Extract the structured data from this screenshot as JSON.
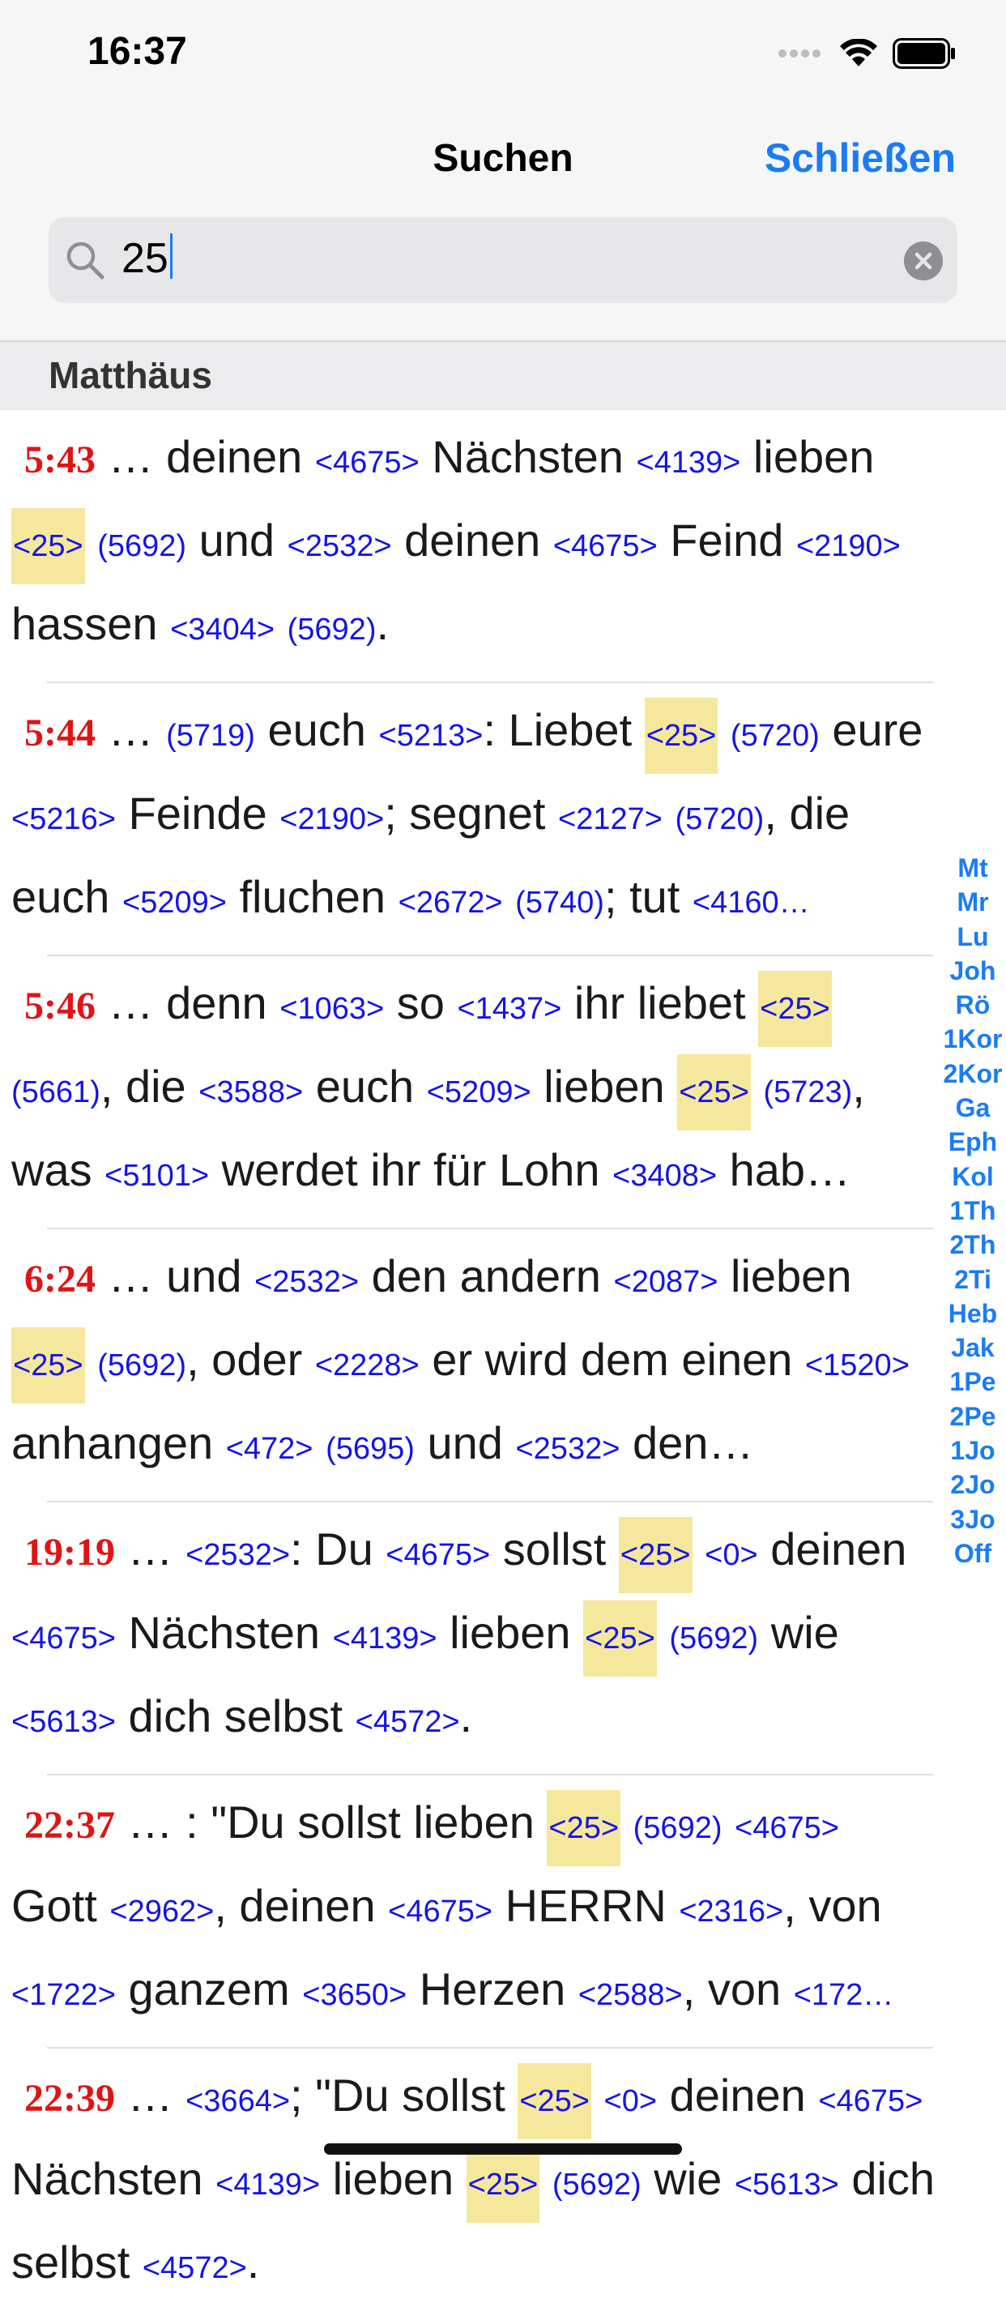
{
  "status": {
    "time": "16:37"
  },
  "nav": {
    "title": "Suchen",
    "close_label": "Schließen"
  },
  "search": {
    "value": "25"
  },
  "section": {
    "title": "Matthäus"
  },
  "verses": [
    {
      "ref": "5:43",
      "parts": [
        {
          "t": "… deinen "
        },
        {
          "n": "<4675>"
        },
        {
          "t": " Nächsten "
        },
        {
          "n": "<4139>"
        },
        {
          "t": " lieben "
        },
        {
          "n": "<25>",
          "hl": true
        },
        {
          "t": " "
        },
        {
          "n": "(5692)"
        },
        {
          "t": " und "
        },
        {
          "n": "<2532>"
        },
        {
          "t": " deinen "
        },
        {
          "n": "<4675>"
        },
        {
          "t": " Feind "
        },
        {
          "n": "<2190>"
        },
        {
          "t": " hassen "
        },
        {
          "n": "<3404>"
        },
        {
          "t": " "
        },
        {
          "n": "(5692)"
        },
        {
          "t": "."
        }
      ]
    },
    {
      "ref": "5:44",
      "parts": [
        {
          "t": "… "
        },
        {
          "n": "(5719)"
        },
        {
          "t": " euch "
        },
        {
          "n": "<5213>"
        },
        {
          "t": ": Liebet "
        },
        {
          "n": "<25>",
          "hl": true
        },
        {
          "t": " "
        },
        {
          "n": "(5720)"
        },
        {
          "t": " eure "
        },
        {
          "n": "<5216>"
        },
        {
          "t": " Feinde "
        },
        {
          "n": "<2190>"
        },
        {
          "t": "; segnet "
        },
        {
          "n": "<2127>"
        },
        {
          "t": " "
        },
        {
          "n": "(5720)"
        },
        {
          "t": ", "
        },
        {
          "t": "die euch "
        },
        {
          "n": "<5209>"
        },
        {
          "t": " fluchen "
        },
        {
          "n": "<2672>"
        },
        {
          "t": " "
        },
        {
          "n": "(5740)"
        },
        {
          "t": "; tut "
        },
        {
          "n": "<4160…"
        }
      ]
    },
    {
      "ref": "5:46",
      "parts": [
        {
          "t": "… denn "
        },
        {
          "n": "<1063>"
        },
        {
          "t": " so "
        },
        {
          "n": "<1437>"
        },
        {
          "t": " ihr liebet "
        },
        {
          "n": "<25>",
          "hl": true
        },
        {
          "t": " "
        },
        {
          "n": "(5661)"
        },
        {
          "t": ", die "
        },
        {
          "n": "<3588>"
        },
        {
          "t": " euch "
        },
        {
          "n": "<5209>"
        },
        {
          "t": " lieben "
        },
        {
          "n": "<25>",
          "hl": true
        },
        {
          "t": " "
        },
        {
          "n": "(5723)"
        },
        {
          "t": ", "
        },
        {
          "t": "was "
        },
        {
          "n": "<5101>"
        },
        {
          "t": " werdet ihr für Lohn "
        },
        {
          "n": "<3408>"
        },
        {
          "t": " hab…"
        }
      ]
    },
    {
      "ref": "6:24",
      "parts": [
        {
          "t": "… und "
        },
        {
          "n": "<2532>"
        },
        {
          "t": " den andern "
        },
        {
          "n": "<2087>"
        },
        {
          "t": " lieben "
        },
        {
          "n": "<25>",
          "hl": true
        },
        {
          "t": " "
        },
        {
          "n": "(5692)"
        },
        {
          "t": ", oder "
        },
        {
          "n": "<2228>"
        },
        {
          "t": " er wird dem einen "
        },
        {
          "n": "<1520>"
        },
        {
          "t": " anhangen "
        },
        {
          "n": "<472>"
        },
        {
          "t": " "
        },
        {
          "n": "(5695)"
        },
        {
          "t": " und "
        },
        {
          "n": "<2532>"
        },
        {
          "t": " den…"
        }
      ]
    },
    {
      "ref": "19:19",
      "parts": [
        {
          "t": "… "
        },
        {
          "n": "<2532>"
        },
        {
          "t": ": Du "
        },
        {
          "n": "<4675>"
        },
        {
          "t": " sollst "
        },
        {
          "n": "<25>",
          "hl": true
        },
        {
          "t": " "
        },
        {
          "n": "<0>"
        },
        {
          "t": " deinen "
        },
        {
          "n": "<4675>"
        },
        {
          "t": " Nächsten "
        },
        {
          "n": "<4139>"
        },
        {
          "t": " lieben "
        },
        {
          "n": "<25>",
          "hl": true
        },
        {
          "t": " "
        },
        {
          "n": "(5692)"
        },
        {
          "t": " wie "
        },
        {
          "n": "<5613>"
        },
        {
          "t": " dich selbst "
        },
        {
          "n": "<4572>"
        },
        {
          "t": "."
        }
      ]
    },
    {
      "ref": "22:37",
      "parts": [
        {
          "t": "… : \"Du sollst lieben "
        },
        {
          "n": "<25>",
          "hl": true
        },
        {
          "t": " "
        },
        {
          "n": "(5692)"
        },
        {
          "t": " "
        },
        {
          "n": "<4675>"
        },
        {
          "t": " Gott "
        },
        {
          "n": "<2962>"
        },
        {
          "t": ", deinen "
        },
        {
          "n": "<4675>"
        },
        {
          "t": " HERRN "
        },
        {
          "n": "<2316>"
        },
        {
          "t": ", von "
        },
        {
          "n": "<1722>"
        },
        {
          "t": " ganzem "
        },
        {
          "n": "<3650>"
        },
        {
          "t": " Herzen "
        },
        {
          "n": "<2588>"
        },
        {
          "t": ", von "
        },
        {
          "n": "<172…"
        }
      ]
    },
    {
      "ref": "22:39",
      "parts": [
        {
          "t": "… "
        },
        {
          "n": "<3664>"
        },
        {
          "t": "; \"Du sollst "
        },
        {
          "n": "<25>",
          "hl": true
        },
        {
          "t": " "
        },
        {
          "n": "<0>"
        },
        {
          "t": " deinen "
        },
        {
          "n": "<4675>"
        },
        {
          "t": " Nächsten "
        },
        {
          "n": "<4139>"
        },
        {
          "t": " lieben "
        },
        {
          "n": "<25>",
          "hl": true
        },
        {
          "t": " "
        },
        {
          "n": "(5692)"
        },
        {
          "t": " wie "
        },
        {
          "n": "<5613>"
        },
        {
          "t": " dich selbst "
        },
        {
          "n": "<4572>"
        },
        {
          "t": "."
        }
      ]
    }
  ],
  "book_index": [
    "Mt",
    "Mr",
    "Lu",
    "Joh",
    "Rö",
    "1Kor",
    "2Kor",
    "Ga",
    "Eph",
    "Kol",
    "1Th",
    "2Th",
    "2Ti",
    "Heb",
    "Jak",
    "1Pe",
    "2Pe",
    "1Jo",
    "2Jo",
    "3Jo",
    "Off"
  ]
}
